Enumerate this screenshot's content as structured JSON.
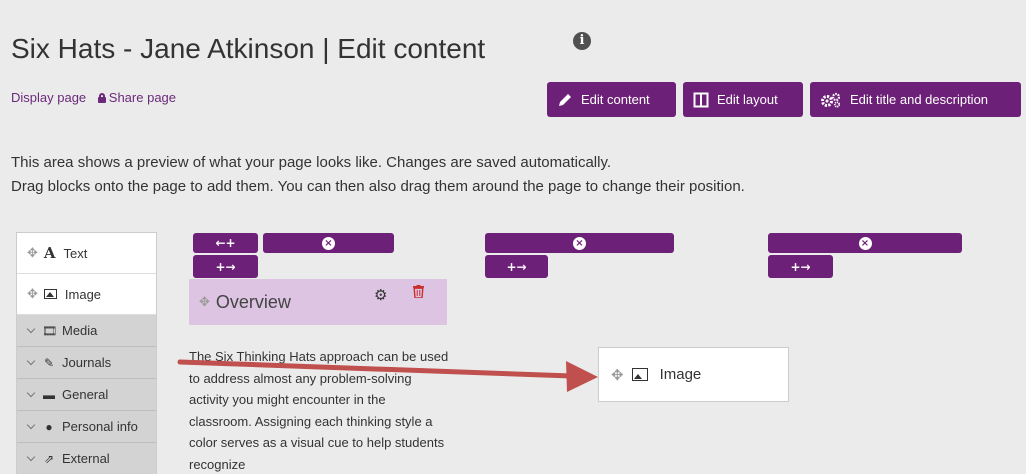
{
  "header": {
    "title": "Six Hats - Jane Atkinson | Edit content",
    "info_icon": "i"
  },
  "links": {
    "display_page": "Display page",
    "share_page": "Share page"
  },
  "toolbar": {
    "edit_content": "Edit content",
    "edit_layout": "Edit layout",
    "edit_title": "Edit title and description"
  },
  "description": {
    "line1": "This area shows a preview of what your page looks like. Changes are saved automatically.",
    "line2": "Drag blocks onto the page to add them. You can then also drag them around the page to change their position."
  },
  "sidebar": {
    "items": [
      {
        "label": "Text",
        "icon": "text-icon"
      },
      {
        "label": "Image",
        "icon": "image-icon"
      }
    ],
    "categories": [
      {
        "label": "Media",
        "icon": "film-icon"
      },
      {
        "label": "Journals",
        "icon": "pencil-icon"
      },
      {
        "label": "General",
        "icon": "briefcase-icon"
      },
      {
        "label": "Personal info",
        "icon": "user-icon"
      },
      {
        "label": "External",
        "icon": "external-link-icon"
      }
    ]
  },
  "layout_controls": {
    "add_left": "←+",
    "add_right": "+→",
    "remove": "×"
  },
  "overview_block": {
    "title": "Overview",
    "text": "The Six Thinking Hats approach can be used to address almost any problem-solving activity you might encounter in the classroom. Assigning each thinking style a color serves as a visual cue to help students recognize"
  },
  "dragged_block": {
    "label": "Image"
  },
  "colors": {
    "accent": "#6d2077",
    "block_header": "#dcc4e2",
    "arrow": "#c0504d"
  }
}
